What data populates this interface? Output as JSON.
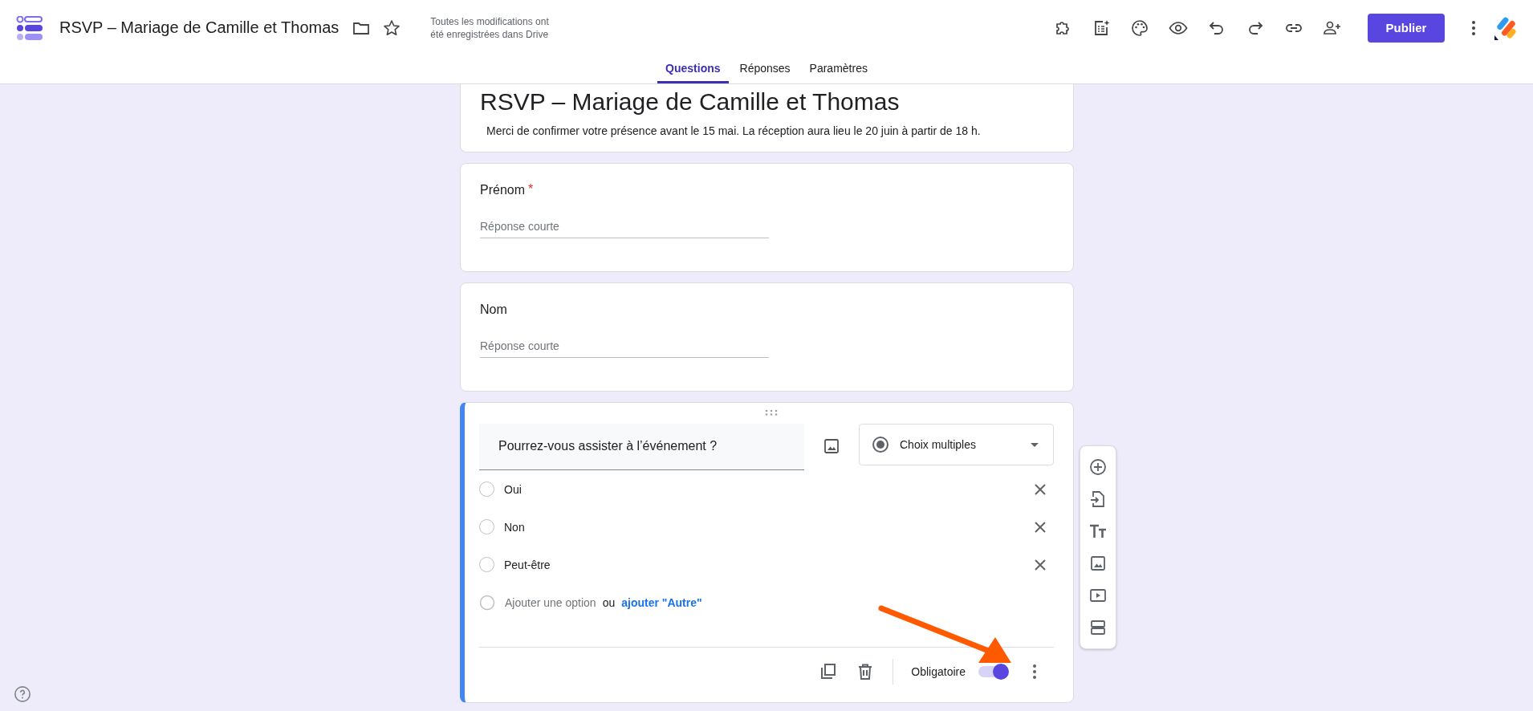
{
  "header": {
    "title": "RSVP – Mariage de Camille et Thomas",
    "save_status": "Toutes les modifications ont été enregistrées dans Drive",
    "publish_button": "Publier"
  },
  "tabs": [
    {
      "label": "Questions",
      "selected": true
    },
    {
      "label": "Réponses",
      "selected": false
    },
    {
      "label": "Paramètres",
      "selected": false
    }
  ],
  "form": {
    "title": "RSVP – Mariage de Camille et Thomas",
    "description": "Merci de confirmer votre présence avant le 15 mai. La réception aura lieu le 20 juin à partir de 18 h."
  },
  "questions": [
    {
      "kind": "short",
      "title": "Prénom",
      "required_mark": "*",
      "placeholder": "Réponse courte"
    },
    {
      "kind": "short",
      "title": "Nom",
      "placeholder": "Réponse courte"
    },
    {
      "kind": "choice",
      "title": "Pourrez-vous assister à l’événement ?",
      "type_label": "Choix multiples",
      "options": [
        {
          "label": "Oui",
          "checked": false
        },
        {
          "label": "Non",
          "checked": false
        },
        {
          "label": "Peut-être",
          "checked": false
        }
      ],
      "add_option": "Ajouter une option",
      "or": "ou",
      "add_other": "ajouter \"Autre\"",
      "required_label": "Obligatoire",
      "required": true
    }
  ]
}
